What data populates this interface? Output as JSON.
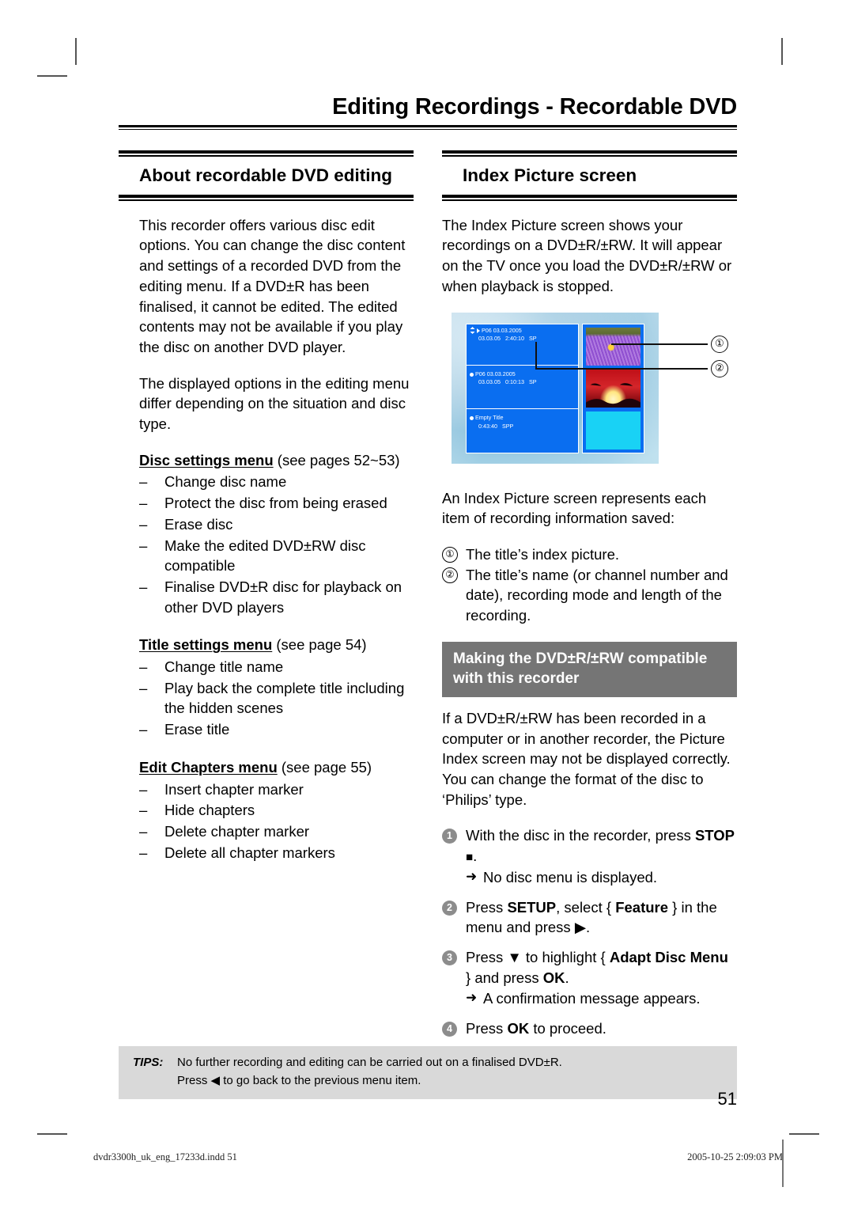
{
  "running_head": "Editing Recordings - Recordable DVD",
  "left_column": {
    "section_title": "About recordable DVD editing",
    "paragraphs": [
      "This recorder offers various disc edit options. You can change the disc content and settings of a recorded DVD from the editing menu. If a DVD±R has been finalised, it cannot be edited. The edited contents may not be available if you play the disc on another DVD player.",
      "The displayed options in the editing menu differ depending on the situation and disc type."
    ],
    "menus": [
      {
        "name": "Disc settings menu",
        "reference": "(see pages 52~53)",
        "items": [
          "Change disc name",
          "Protect the disc from being erased",
          "Erase disc",
          "Make the edited DVD±RW disc compatible",
          "Finalise DVD±R disc for playback on other DVD players"
        ]
      },
      {
        "name": "Title settings menu",
        "reference": "(see page 54)",
        "items": [
          "Change title name",
          "Play back the complete title including the hidden scenes",
          "Erase title"
        ]
      },
      {
        "name": "Edit Chapters menu",
        "reference": "(see page 55)",
        "items": [
          "Insert chapter marker",
          "Hide chapters",
          "Delete chapter marker",
          "Delete all chapter markers"
        ]
      }
    ]
  },
  "right_column": {
    "section_title": "Index Picture screen",
    "intro": "The Index Picture screen shows your recordings on a DVD±R/±RW. It will appear on the TV once you load the DVD±R/±RW or when playback is stopped.",
    "tv_screen": {
      "entries": [
        {
          "title": "P06 03.03.2005",
          "detail": "03.03.05   2:40:10   SP",
          "selected": true
        },
        {
          "title": "P06 03.03.2005",
          "detail": "03.03.05   0:10:13   SP",
          "selected": false
        },
        {
          "title": "Empty Title",
          "detail": "0:43:40   SPP",
          "selected": false
        }
      ],
      "thumbnails": [
        "anemone-thumbnail",
        "sunset-thumbnail",
        "empty-thumbnail"
      ],
      "callouts": [
        "①",
        "②"
      ]
    },
    "represents_intro": "An Index Picture screen represents each item of recording information saved:",
    "represents_items": [
      {
        "num": "①",
        "text": "The title’s index picture."
      },
      {
        "num": "②",
        "text": "The title’s name (or channel number and date), recording mode and length of the recording."
      }
    ],
    "banner": "Making the DVD±R/±RW compatible with this recorder",
    "banner_paragraph": "If a DVD±R/±RW has been recorded in a computer or in another recorder, the Picture Index screen may not be displayed correctly.  You can change the format of the disc to ‘Philips’ type.",
    "steps": [
      {
        "num": "1",
        "parts": [
          {
            "t": "With the disc in the recorder, press ",
            "b": false
          },
          {
            "t": "STOP",
            "b": true
          },
          {
            "t": " ■.",
            "b": false
          }
        ],
        "result": "No disc menu is displayed."
      },
      {
        "num": "2",
        "parts": [
          {
            "t": "Press ",
            "b": false
          },
          {
            "t": "SETUP",
            "b": true
          },
          {
            "t": ", select { ",
            "b": false
          },
          {
            "t": "Feature",
            "b": true
          },
          {
            "t": " } in the menu and press ▶.",
            "b": false
          }
        ],
        "result": ""
      },
      {
        "num": "3",
        "parts": [
          {
            "t": "Press ▼ to highlight { ",
            "b": false
          },
          {
            "t": "Adapt Disc Menu",
            "b": true
          },
          {
            "t": " } and press ",
            "b": false
          },
          {
            "t": "OK",
            "b": true
          },
          {
            "t": ".",
            "b": false
          }
        ],
        "result": "A confirmation message appears."
      },
      {
        "num": "4",
        "parts": [
          {
            "t": "Press ",
            "b": false
          },
          {
            "t": "OK",
            "b": true
          },
          {
            "t": " to proceed.",
            "b": false
          }
        ],
        "result": ""
      }
    ]
  },
  "tips": {
    "label": "TIPS:",
    "line1": "No further recording and editing can be carried out on a finalised DVD±R.",
    "line2": "Press ◀ to go back to the previous menu item."
  },
  "page_number": "51",
  "print_meta": {
    "file": "dvdr3300h_uk_eng_17233d.indd   51",
    "timestamp": "2005-10-25   2:09:03 PM"
  }
}
